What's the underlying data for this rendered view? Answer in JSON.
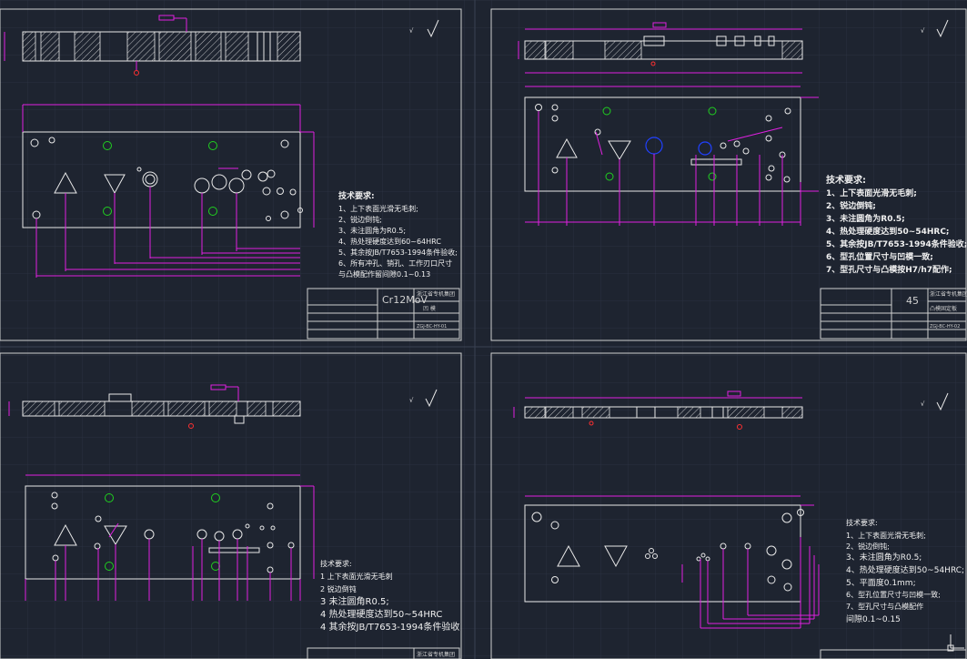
{
  "quadrants": {
    "top_left": {
      "notes_title": "技术要求:",
      "notes": [
        "1、上下表面光滑无毛刺;",
        "2、锐边倒钝;",
        "3、未注圆角为R0.5;",
        "4、热处理硬度达到60~64HRC",
        "5、其余按JB/T7653-1994条件验收;",
        "6、所有冲孔、销孔、工作刃口尺寸",
        "   与凸模配作留间隙0.1~0.13"
      ],
      "material": "Cr12MoV",
      "company": "浙江省专机集团",
      "part_name": "凹 模",
      "drawing_no": "ZGJ-BC-HY-01"
    },
    "top_right": {
      "notes_title": "技术要求:",
      "notes": [
        "1、上下表面光滑无毛刺;",
        "2、锐边倒钝;",
        "3、未注圆角为R0.5;",
        "4、热处理硬度达到50~54HRC;",
        "5、其余按JB/T7653-1994条件验收;",
        "6、型孔位置尺寸与凹模一致;",
        "7、型孔尺寸与凸模按H7/h7配作;"
      ],
      "material": "45",
      "company": "浙江省专机集团",
      "part_name": "凸模固定板",
      "drawing_no": "ZGJ-BC-HY-02"
    },
    "bottom_left": {
      "notes_title": "技术要求:",
      "notes": [
        "1  上下表面光滑无毛刺",
        "2  锐边倒钝",
        "3  未注圆角R0.5;",
        "4  热处理硬度达到50~54HRC",
        "4  其余按JB/T7653-1994条件验收"
      ],
      "company": "浙江省专机集团"
    },
    "bottom_right": {
      "notes_title": "技术要求:",
      "notes": [
        "1、上下表面光滑无毛刺;",
        "2、锐边倒钝;",
        "3、未注圆角为R0.5;",
        "4、热处理硬度达到50~54HRC;",
        "5、平面度0.1mm;",
        "6、型孔位置尺寸与凹模一致;",
        "7、型孔尺寸与凸模配作",
        "   间隙0.1~0.15"
      ]
    }
  },
  "colors": {
    "background": "#1e2430",
    "dimension": "#e020e0",
    "geometry": "#e8e8e8",
    "center_holes": "#20d020",
    "highlight": "#2040ff"
  }
}
